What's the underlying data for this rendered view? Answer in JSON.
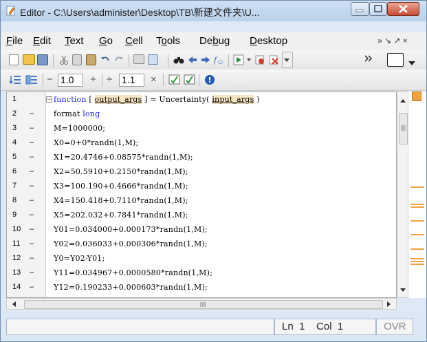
{
  "window": {
    "title": "Editor - C:\\Users\\administer\\Desktop\\TB\\新建文件夹\\U..."
  },
  "menu": {
    "items": [
      {
        "label": "File",
        "u": "F",
        "rest": "ile"
      },
      {
        "label": "Edit",
        "u": "E",
        "rest": "dit"
      },
      {
        "label": "Text",
        "u": "T",
        "rest": "ext"
      },
      {
        "label": "Go",
        "u": "G",
        "rest": "o"
      },
      {
        "label": "Cell",
        "u": "C",
        "rest": "ell"
      },
      {
        "label": "Tools",
        "pre": "T",
        "u": "o",
        "rest": "ols"
      },
      {
        "label": "Debug",
        "pre": "De",
        "u": "b",
        "rest": "ug"
      },
      {
        "label": "Desktop",
        "u": "D",
        "rest": "esktop"
      }
    ],
    "right_symbols": "»  ↘  ↗ ×"
  },
  "toolbar2": {
    "minus": "−",
    "field1_value": "1.0",
    "plus": "+",
    "divide": "÷",
    "field2_value": "1.1",
    "times": "×"
  },
  "editor": {
    "lines": [
      {
        "n": "1",
        "dash": "",
        "code_prefix": "function [ ",
        "kw": "function",
        "out": "output_args",
        "mid": " ] = Uncertainty( ",
        "in": "input_args",
        "end": " )"
      },
      {
        "n": "2",
        "dash": "–",
        "code": "format ",
        "code_kw": "long"
      },
      {
        "n": "3",
        "dash": "–",
        "code": "M=1000000;"
      },
      {
        "n": "4",
        "dash": "–",
        "code": "X0=0+0*randn(1,M);"
      },
      {
        "n": "5",
        "dash": "–",
        "code": "X1=20.4746+0.08575*randn(1,M);"
      },
      {
        "n": "6",
        "dash": "–",
        "code": "X2=50.5910+0.2150*randn(1,M);"
      },
      {
        "n": "7",
        "dash": "–",
        "code": "X3=100.190+0.4666*randn(1,M);"
      },
      {
        "n": "8",
        "dash": "–",
        "code": "X4=150.418+0.7110*randn(1,M);"
      },
      {
        "n": "9",
        "dash": "–",
        "code": "X5=202.032+0.7841*randn(1,M);"
      },
      {
        "n": "10",
        "dash": "–",
        "code": "Y01=0.034000+0.000173*randn(1,M);"
      },
      {
        "n": "11",
        "dash": "–",
        "code": "Y02=0.036033+0.000306*randn(1,M);"
      },
      {
        "n": "12",
        "dash": "–",
        "code": "Y0=Y02-Y01;"
      },
      {
        "n": "13",
        "dash": "–",
        "code": "Y11=0.034967+0.0000580*randn(1,M);"
      },
      {
        "n": "14",
        "dash": "–",
        "code": "Y12=0.190233+0.000603*randn(1,M);"
      }
    ]
  },
  "status": {
    "ln_label": "Ln",
    "ln_value": "1",
    "col_label": "Col",
    "col_value": "1",
    "ovr": "OVR"
  },
  "colors": {
    "keyword": "#1a1aff",
    "highlight": "#f6e7c4",
    "mlint_marker": "#f2a140"
  }
}
